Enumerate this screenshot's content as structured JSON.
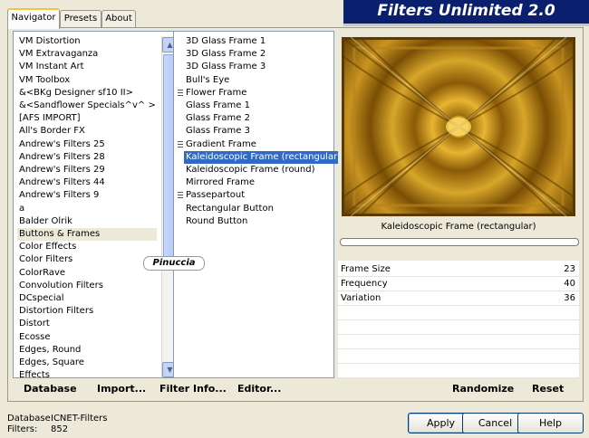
{
  "tabs": [
    {
      "label": "Navigator",
      "active": true
    },
    {
      "label": "Presets",
      "active": false
    },
    {
      "label": "About",
      "active": false
    }
  ],
  "app_title": "Filters Unlimited 2.0",
  "categories": [
    "VM Distortion",
    "VM Extravaganza",
    "VM Instant Art",
    "VM Toolbox",
    "&<BKg Designer sf10 II>",
    "&<Sandflower Specials^v^ >",
    "[AFS IMPORT]",
    "All's Border FX",
    "Andrew's Filters 25",
    "Andrew's Filters 28",
    "Andrew's Filters 29",
    "Andrew's Filters 44",
    "Andrew's Filters 9",
    "a",
    "Balder Olrik",
    "Buttons & Frames",
    "Color Effects",
    "Color Filters",
    "ColorRave",
    "Convolution Filters",
    "DCspecial",
    "Distortion Filters",
    "Distort",
    "Ecosse",
    "Edges, Round",
    "Edges, Square",
    "Effects"
  ],
  "selected_category": "Buttons & Frames",
  "filters": [
    {
      "label": "3D Glass Frame 1",
      "grip": false
    },
    {
      "label": "3D Glass Frame 2",
      "grip": false
    },
    {
      "label": "3D Glass Frame 3",
      "grip": false
    },
    {
      "label": "Bull's Eye",
      "grip": false
    },
    {
      "label": "Flower Frame",
      "grip": true
    },
    {
      "label": "Glass Frame 1",
      "grip": false
    },
    {
      "label": "Glass Frame 2",
      "grip": false
    },
    {
      "label": "Glass Frame 3",
      "grip": false
    },
    {
      "label": "Gradient Frame",
      "grip": true
    },
    {
      "label": "Kaleidoscopic Frame (rectangular)",
      "grip": false
    },
    {
      "label": "Kaleidoscopic Frame (round)",
      "grip": false
    },
    {
      "label": "Mirrored Frame",
      "grip": false
    },
    {
      "label": "Passepartout",
      "grip": true
    },
    {
      "label": "Rectangular Button",
      "grip": false
    },
    {
      "label": "Round Button",
      "grip": false
    }
  ],
  "selected_filter": "Kaleidoscopic Frame (rectangular)",
  "preview_filter_name": "Kaleidoscopic Frame (rectangular)",
  "params": [
    {
      "label": "Frame Size",
      "value": "23"
    },
    {
      "label": "Frequency",
      "value": "40"
    },
    {
      "label": "Variation",
      "value": "36"
    }
  ],
  "bottom_buttons": {
    "database": "Database",
    "import": "Import...",
    "filter_info": "Filter Info...",
    "editor": "Editor...",
    "randomize": "Randomize",
    "reset": "Reset"
  },
  "info": {
    "database_label": "Database:",
    "database_value": "ICNET-Filters",
    "filters_label": "Filters:",
    "filters_value": "852"
  },
  "dialog_buttons": {
    "apply": "Apply",
    "cancel": "Cancel",
    "help": "Help"
  },
  "watermark": "Pinuccia",
  "colors": {
    "title_bg": "#0a1f6e",
    "selection": "#316ac5",
    "preview_gold": "#d7a629"
  }
}
